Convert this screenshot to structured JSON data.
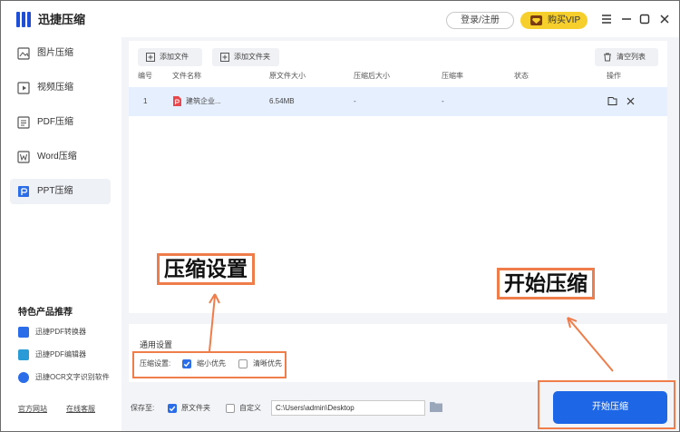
{
  "app": {
    "title": "迅捷压缩",
    "login_label": "登录/注册",
    "vip_label": "购买VIP"
  },
  "sidebar": {
    "items": [
      {
        "label": "图片压缩",
        "icon": "image-icon"
      },
      {
        "label": "视频压缩",
        "icon": "video-icon"
      },
      {
        "label": "PDF压缩",
        "icon": "pdf-icon"
      },
      {
        "label": "Word压缩",
        "icon": "word-icon"
      },
      {
        "label": "PPT压缩",
        "icon": "ppt-icon",
        "active": true
      }
    ],
    "promo_title": "特色产品推荐",
    "promo_items": [
      {
        "label": "迅捷PDF转换器",
        "color": "#2b6de8"
      },
      {
        "label": "迅捷PDF编辑器",
        "color": "#2a9bd6"
      },
      {
        "label": "迅捷OCR文字识别软件",
        "color": "#2b6de8"
      }
    ],
    "footer_links": [
      "官方网站",
      "在线客服"
    ]
  },
  "toolbar": {
    "add_file": "添加文件",
    "add_folder": "添加文件夹",
    "clear_list": "清空列表"
  },
  "table": {
    "columns": [
      "编号",
      "文件名称",
      "原文件大小",
      "压缩后大小",
      "压缩率",
      "状态",
      "操作"
    ],
    "rows": [
      {
        "index": "1",
        "name": "建筑企业...",
        "original_size": "6.54MB",
        "compressed_size": "-",
        "ratio": "-",
        "status": ""
      }
    ]
  },
  "settings": {
    "title": "通用设置",
    "label": "压缩设置:",
    "options": [
      {
        "label": "缩小优先",
        "checked": true
      },
      {
        "label": "清晰优先",
        "checked": false
      }
    ]
  },
  "save": {
    "label": "保存至:",
    "option_original": "原文件夹",
    "option_original_checked": true,
    "option_custom": "自定义",
    "option_custom_checked": false,
    "path": "C:\\Users\\admin\\Desktop"
  },
  "start_button": "开始压缩",
  "annotations": {
    "settings_label": "压缩设置",
    "start_label": "开始压缩"
  },
  "colors": {
    "accent": "#1d66e5",
    "annotation": "#ef7d4b",
    "vip": "#f7cf2c",
    "row_highlight": "#e6effd",
    "pdf_red": "#e8484b"
  }
}
